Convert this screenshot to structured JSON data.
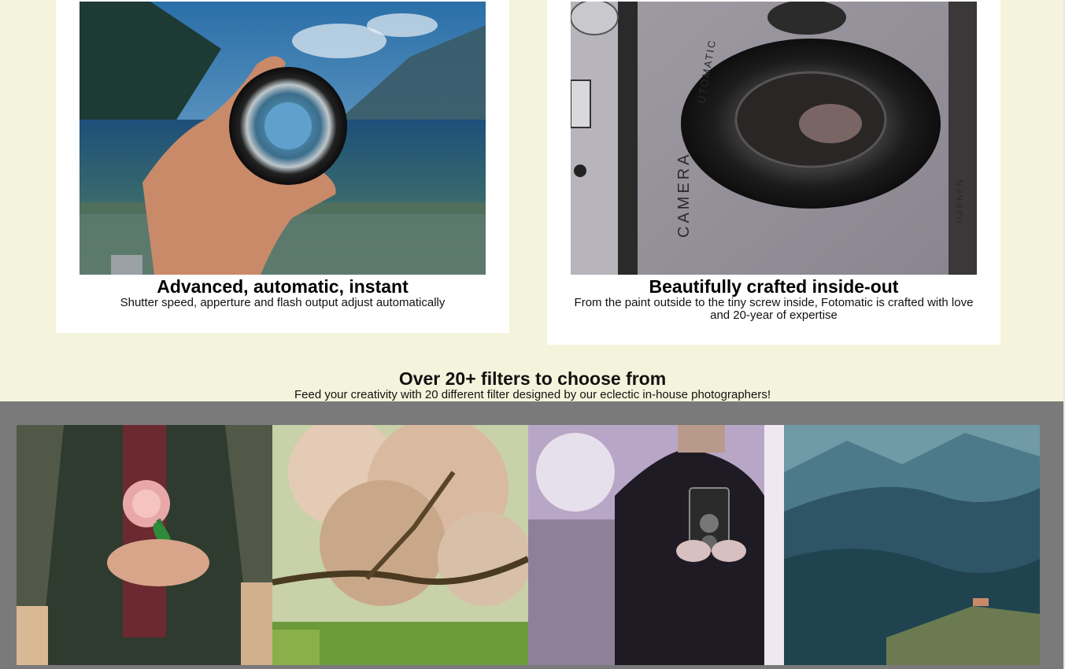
{
  "features": [
    {
      "title": "Advanced, automatic, instant",
      "description": "Shutter speed, apperture and flash output adjust automatically",
      "image": "lens-over-lake-photo"
    },
    {
      "title": "Beautifully crafted inside-out",
      "description": "From the paint outside to the tiny screw inside, Fotomatic is crafted with love and 20-year of expertise",
      "image": "vintage-camera-closeup-photo"
    }
  ],
  "filters": {
    "title": "Over 20+ filters to choose from",
    "subtitle": "Feed your creativity with 20 different filter designed by our eclectic in-house photographers!",
    "images": [
      "woman-holding-flower-photo",
      "blossom-tree-photo",
      "man-with-twin-lens-camera-photo",
      "mountain-valley-photo"
    ]
  },
  "camera_labels": {
    "camera": "CAMERA",
    "darken": "DARKEN",
    "automatic": "UTOMATIC"
  },
  "colors": {
    "page_background": "#f4f4dc",
    "card_background": "#ffffff",
    "gallery_background": "#7a7a7a"
  }
}
